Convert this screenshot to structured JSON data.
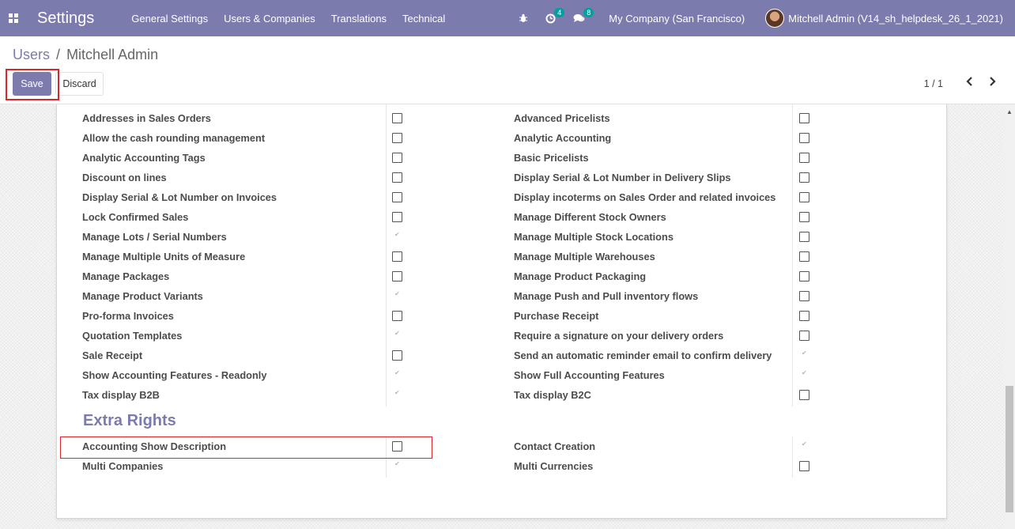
{
  "navbar": {
    "apps_icon": "grid-icon",
    "brand": "Settings",
    "menu": [
      "General Settings",
      "Users & Companies",
      "Translations",
      "Technical"
    ],
    "debug_icon": "bug-icon",
    "activity_icon": "clock-icon",
    "activity_count": "4",
    "messages_icon": "comments-icon",
    "messages_count": "8",
    "company": "My Company (San Francisco)",
    "user": "Mitchell Admin (V14_sh_helpdesk_26_1_2021)"
  },
  "breadcrumb": {
    "parent": "Users",
    "separator": "/",
    "current": "Mitchell Admin"
  },
  "buttons": {
    "save": "Save",
    "discard": "Discard"
  },
  "pager": {
    "value": "1 / 1"
  },
  "technical_settings": {
    "left": [
      {
        "label": "Addresses in Sales Orders",
        "checked": false
      },
      {
        "label": "Allow the cash rounding management",
        "checked": false
      },
      {
        "label": "Analytic Accounting Tags",
        "checked": false
      },
      {
        "label": "Discount on lines",
        "checked": false
      },
      {
        "label": "Display Serial & Lot Number on Invoices",
        "checked": false
      },
      {
        "label": "Lock Confirmed Sales",
        "checked": false
      },
      {
        "label": "Manage Lots / Serial Numbers",
        "checked": true
      },
      {
        "label": "Manage Multiple Units of Measure",
        "checked": false
      },
      {
        "label": "Manage Packages",
        "checked": false
      },
      {
        "label": "Manage Product Variants",
        "checked": true
      },
      {
        "label": "Pro-forma Invoices",
        "checked": false
      },
      {
        "label": "Quotation Templates",
        "checked": true
      },
      {
        "label": "Sale Receipt",
        "checked": false
      },
      {
        "label": "Show Accounting Features - Readonly",
        "checked": true
      },
      {
        "label": "Tax display B2B",
        "checked": true
      }
    ],
    "right": [
      {
        "label": "Advanced Pricelists",
        "checked": false
      },
      {
        "label": "Analytic Accounting",
        "checked": false
      },
      {
        "label": "Basic Pricelists",
        "checked": false
      },
      {
        "label": "Display Serial & Lot Number in Delivery Slips",
        "checked": false
      },
      {
        "label": "Display incoterms on Sales Order and related invoices",
        "checked": false
      },
      {
        "label": "Manage Different Stock Owners",
        "checked": false
      },
      {
        "label": "Manage Multiple Stock Locations",
        "checked": false
      },
      {
        "label": "Manage Multiple Warehouses",
        "checked": false
      },
      {
        "label": "Manage Product Packaging",
        "checked": false
      },
      {
        "label": "Manage Push and Pull inventory flows",
        "checked": false
      },
      {
        "label": "Purchase Receipt",
        "checked": false
      },
      {
        "label": "Require a signature on your delivery orders",
        "checked": false
      },
      {
        "label": "Send an automatic reminder email to confirm delivery",
        "checked": true
      },
      {
        "label": "Show Full Accounting Features",
        "checked": true
      },
      {
        "label": "Tax display B2C",
        "checked": false
      }
    ]
  },
  "extra_rights": {
    "title": "Extra Rights",
    "left": [
      {
        "label": "Accounting Show Description",
        "checked": false
      },
      {
        "label": "Multi Companies",
        "checked": true
      }
    ],
    "right": [
      {
        "label": "Contact Creation",
        "checked": true
      },
      {
        "label": "Multi Currencies",
        "checked": false
      }
    ]
  },
  "colors": {
    "brand": "#7c7bad",
    "highlight": "#d9262c",
    "badge": "#00a09d"
  }
}
